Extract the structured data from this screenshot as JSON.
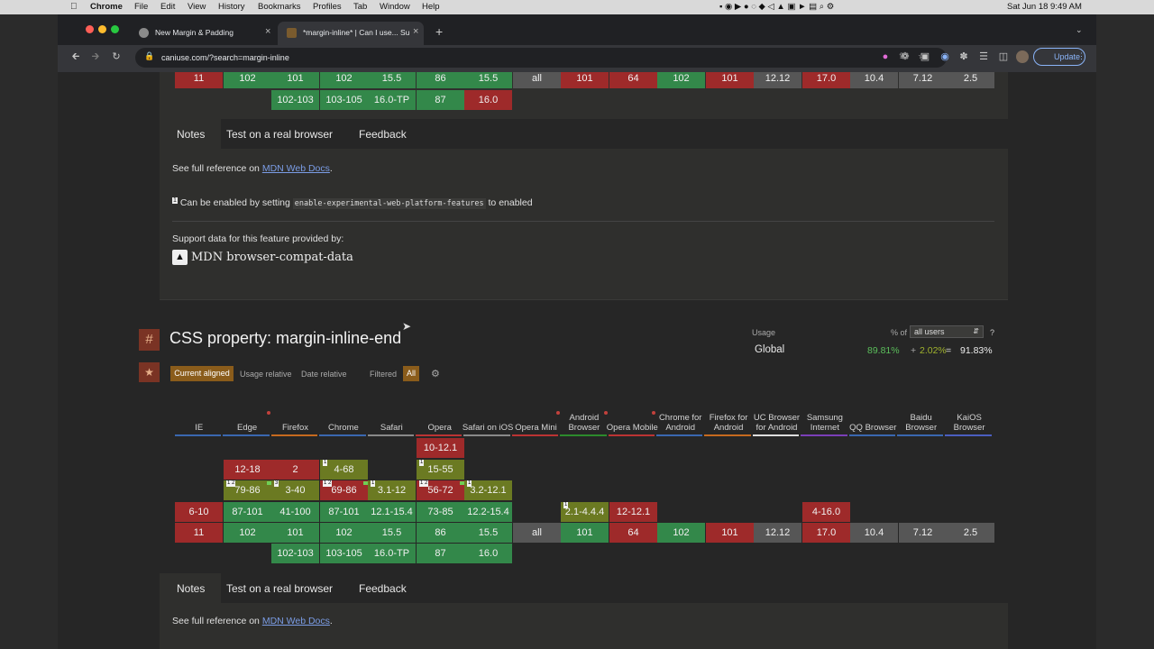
{
  "menubar": {
    "app": "Chrome",
    "items": [
      "File",
      "Edit",
      "View",
      "History",
      "Bookmarks",
      "Profiles",
      "Tab",
      "Window",
      "Help"
    ],
    "clock": "Sat Jun 18  9:49 AM"
  },
  "tabs": [
    {
      "title": "New Margin & Padding"
    },
    {
      "title": "*margin-inline* | Can I use... Su"
    }
  ],
  "toolbar": {
    "url": "caniuse.com/?search=margin-inline",
    "update_label": "Update"
  },
  "top_table": {
    "row1": [
      "11",
      "102",
      "101",
      "102",
      "15.5",
      "86",
      "15.5",
      "all",
      "101",
      "64",
      "102",
      "101",
      "12.12",
      "17.0",
      "10.4",
      "7.12",
      "2.5"
    ],
    "row2": [
      "102-103",
      "103-105",
      "16.0-TP",
      "87",
      "16.0"
    ]
  },
  "notes_tabs": [
    "Notes",
    "Test on a real browser",
    "Feedback"
  ],
  "card1": {
    "mdn_prefix": "See full reference on",
    "mdn_link": "MDN Web Docs",
    "mdn_suffix": ".",
    "note_number": "1",
    "note_pre": "Can be enabled by setting",
    "note_code": "enable-experimental-web-platform-features",
    "note_post": "to enabled",
    "support_label": "Support data for this feature provided by:",
    "provider": "MDN browser-compat-data"
  },
  "feature": {
    "hash": "#",
    "title": "CSS property: margin-inline-end",
    "usage_label": "Usage",
    "percent_of": "% of",
    "users_select": "all users",
    "help": "?",
    "global_label": "Global",
    "full_support": "89.81%",
    "plus": "+",
    "partial_support": "2.02%",
    "equals": "=",
    "total": "91.83%",
    "views": [
      "Current aligned",
      "Usage relative",
      "Date relative"
    ],
    "filtered": "Filtered",
    "all": "All"
  },
  "browsers": [
    {
      "name": "IE"
    },
    {
      "name": "Edge"
    },
    {
      "name": "Firefox"
    },
    {
      "name": "Chrome"
    },
    {
      "name": "Safari"
    },
    {
      "name": "Opera"
    },
    {
      "name": "Safari on iOS"
    },
    {
      "name": "Opera Mini"
    },
    {
      "name": "Android Browser"
    },
    {
      "name": "Opera Mobile"
    },
    {
      "name": "Chrome for Android"
    },
    {
      "name": "Firefox for Android"
    },
    {
      "name": "UC Browser for Android"
    },
    {
      "name": "Samsung Internet"
    },
    {
      "name": "QQ Browser"
    },
    {
      "name": "Baidu Browser"
    },
    {
      "name": "KaiOS Browser"
    }
  ],
  "support": {
    "opera_old": "10-12.1",
    "edge_1": "12-18",
    "firefox_1": "2",
    "chrome_1": "4-68",
    "opera_2": "15-55",
    "edge_2": "79-86",
    "firefox_2": "3-40",
    "chrome_2": "69-86",
    "safari_2": "3.1-12",
    "opera_3": "56-72",
    "ios_2": "3.2-12.1",
    "row_prev": [
      "6-10",
      "87-101",
      "41-100",
      "87-101",
      "12.1-15.4",
      "73-85",
      "12.2-15.4",
      "2.1-4.4.4",
      "12-12.1",
      "4-16.0"
    ],
    "row_current": [
      "11",
      "102",
      "101",
      "102",
      "15.5",
      "86",
      "15.5",
      "all",
      "101",
      "64",
      "102",
      "101",
      "12.12",
      "17.0",
      "10.4",
      "7.12",
      "2.5"
    ],
    "row_future": [
      "102-103",
      "103-105",
      "16.0-TP",
      "87",
      "16.0"
    ],
    "flags": {
      "one": "1",
      "two": "2",
      "three": "3",
      "onetwo": "1 2"
    }
  },
  "card2": {
    "mdn_prefix": "See full reference on",
    "mdn_link": "MDN Web Docs",
    "mdn_suffix": "."
  },
  "colors": {
    "supported": "#33884a",
    "unsupported": "#9e2a2a",
    "partial": "#6b7a22",
    "accent": "#c8a040"
  }
}
